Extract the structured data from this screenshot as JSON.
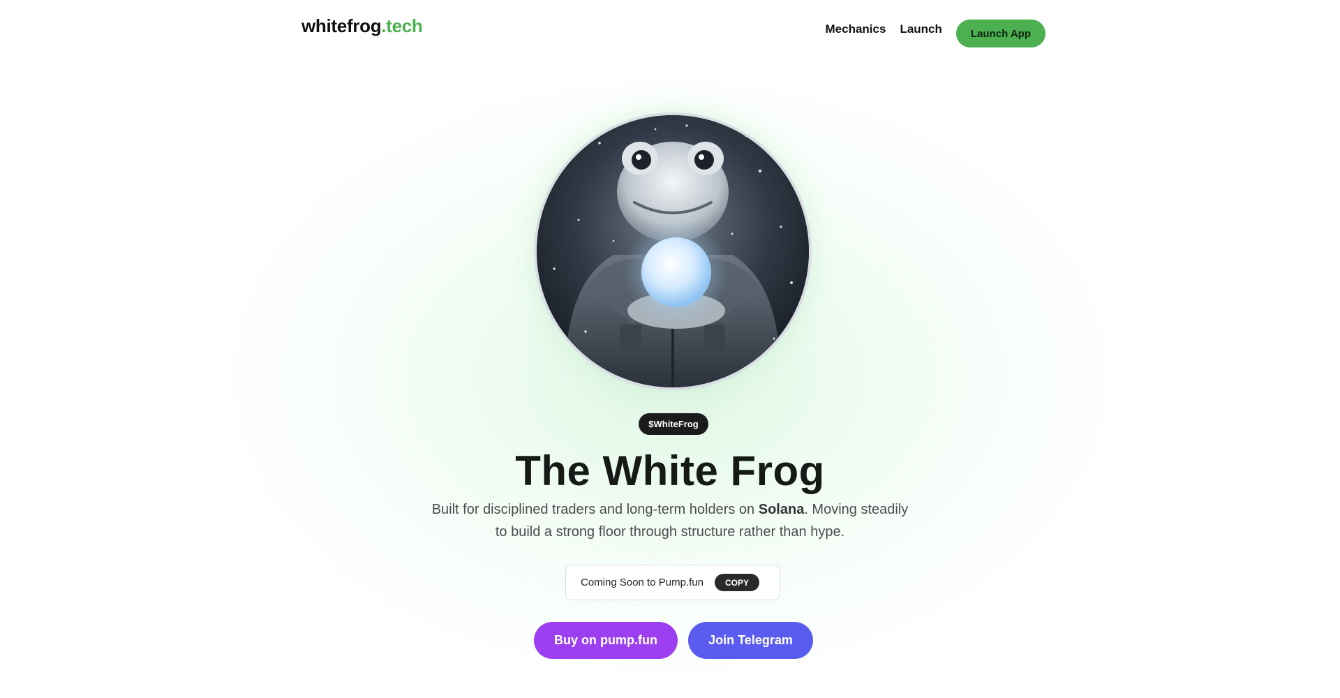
{
  "header": {
    "logo_main": "whitefrog",
    "logo_accent": ".tech",
    "nav": [
      {
        "label": "Mechanics"
      },
      {
        "label": "Launch"
      }
    ],
    "launch_app_label": "Launch App"
  },
  "hero": {
    "ticker": "$WhiteFrog",
    "title": "The White Frog",
    "subtitle_part1": "Built for disciplined traders and long-term holders on ",
    "subtitle_bold": "Solana",
    "subtitle_part2": ". Moving steadily to build a strong floor through structure rather than hype.",
    "contract_text": "Coming Soon to Pump.fun",
    "copy_label": "COPY",
    "buy_label": "Buy on pump.fun",
    "telegram_label": "Join Telegram"
  },
  "colors": {
    "accent_green": "#4caf50",
    "buy_purple": "#9b3ff0",
    "telegram_blue": "#5a5cf0",
    "dark": "#1b1b1b"
  },
  "icons": {
    "avatar": "white-frog-holding-snowball-image"
  }
}
